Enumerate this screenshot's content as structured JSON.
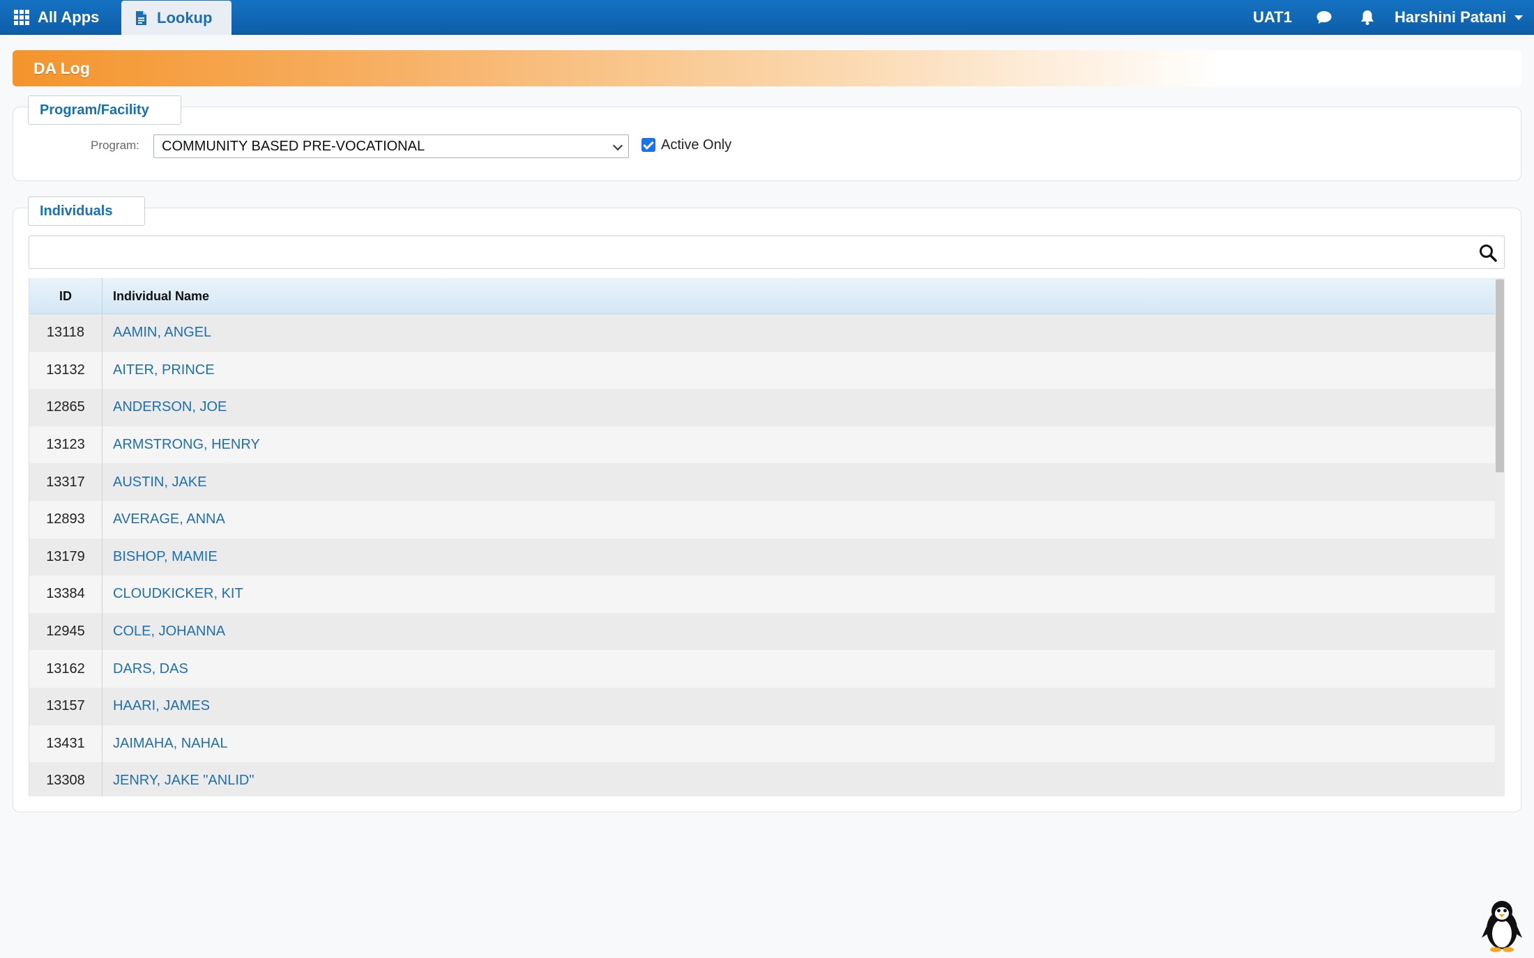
{
  "topbar": {
    "apps_label": "All Apps",
    "apps_icon": "grid-icon",
    "active_tab_label": "Lookup",
    "active_tab_icon": "document-icon",
    "environment": "UAT1",
    "chat_icon": "chat-icon",
    "notifications_icon": "bell-icon",
    "user_name": "Harshini Patani",
    "brand_color": "#1572c2"
  },
  "page": {
    "title": "DA Log",
    "accent_color": "#f4942b"
  },
  "program_panel": {
    "legend": "Program/Facility",
    "program_label": "Program:",
    "program_value": "COMMUNITY BASED PRE-VOCATIONAL",
    "active_only_label": "Active Only",
    "active_only_checked": true
  },
  "individuals_panel": {
    "legend": "Individuals",
    "search_value": "",
    "search_icon": "search-icon",
    "columns": [
      "ID",
      "Individual Name"
    ],
    "rows": [
      {
        "id": "13118",
        "name": "AAMIN, ANGEL"
      },
      {
        "id": "13132",
        "name": "AITER, PRINCE"
      },
      {
        "id": "12865",
        "name": "ANDERSON, JOE"
      },
      {
        "id": "13123",
        "name": "ARMSTRONG, HENRY"
      },
      {
        "id": "13317",
        "name": "AUSTIN, JAKE"
      },
      {
        "id": "12893",
        "name": "AVERAGE, ANNA"
      },
      {
        "id": "13179",
        "name": "BISHOP, MAMIE"
      },
      {
        "id": "13384",
        "name": "CLOUDKICKER, KIT"
      },
      {
        "id": "12945",
        "name": "COLE, JOHANNA"
      },
      {
        "id": "13162",
        "name": "DARS, DAS"
      },
      {
        "id": "13157",
        "name": "HAARI, JAMES"
      },
      {
        "id": "13431",
        "name": "JAIMAHA, NAHAL"
      },
      {
        "id": "13308",
        "name": "JENRY, JAKE \"ANLID\""
      }
    ],
    "link_color": "#1f6fae"
  },
  "mascot_icon": "penguin-icon"
}
